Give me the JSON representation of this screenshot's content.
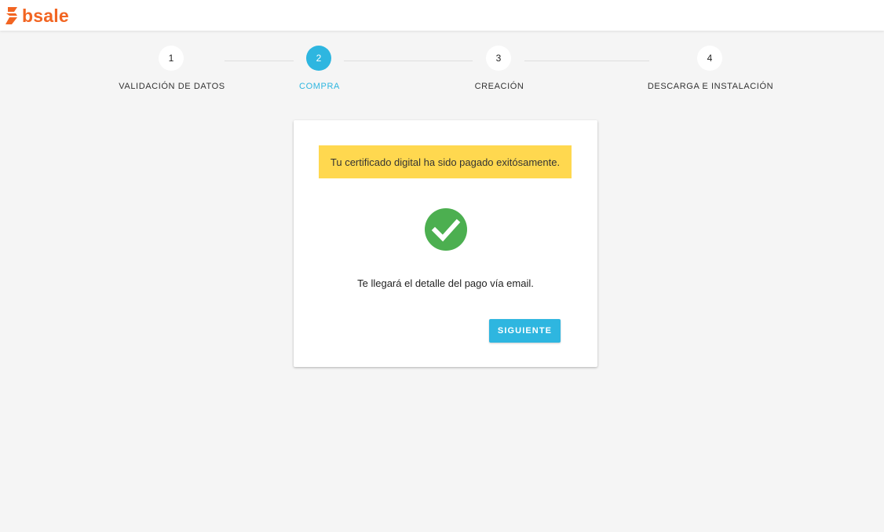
{
  "header": {
    "logo_text": "bsale",
    "brand_color": "#f26522"
  },
  "stepper": {
    "steps": [
      {
        "number": "1",
        "label": "VALIDACIÓN DE DATOS",
        "active": false
      },
      {
        "number": "2",
        "label": "COMPRA",
        "active": true
      },
      {
        "number": "3",
        "label": "CREACIÓN",
        "active": false
      },
      {
        "number": "4",
        "label": "DESCARGA E INSTALACIÓN",
        "active": false
      }
    ],
    "active_color": "#2eb6e0"
  },
  "card": {
    "alert_text": "Tu certificado digital ha sido pagado exitósamente.",
    "alert_color": "#ffd84f",
    "success_icon": "check-circle-icon",
    "success_color": "#4caf50",
    "message": "Te llegará el detalle del pago vía email.",
    "next_button_label": "SIGUIENTE"
  }
}
